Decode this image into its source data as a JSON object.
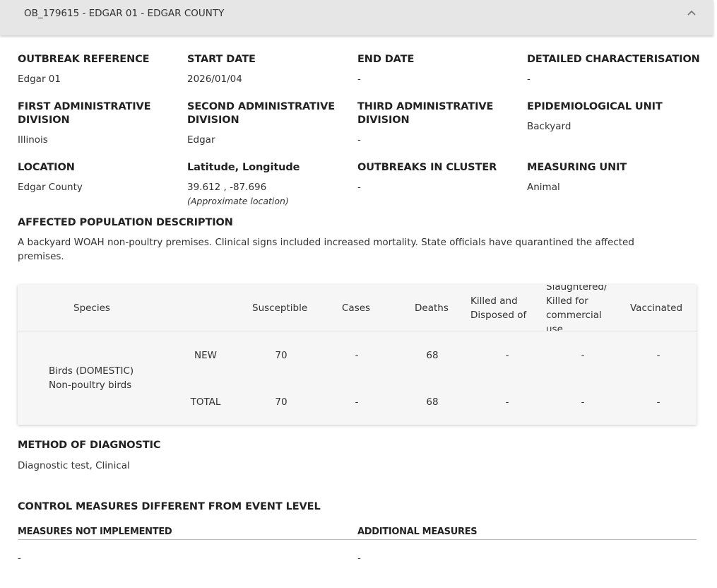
{
  "header": {
    "title": "OB_179615 - EDGAR 01 - EDGAR COUNTY",
    "toggle_icon": "chevron-up-icon"
  },
  "fields": {
    "outbreak_reference": {
      "label": "OUTBREAK REFERENCE",
      "value": "Edgar 01"
    },
    "start_date": {
      "label": "START DATE",
      "value": "2026/01/04"
    },
    "end_date": {
      "label": "END DATE",
      "value": "-"
    },
    "detailed_characterisation": {
      "label": "DETAILED CHARACTERISATION",
      "value": "-"
    },
    "first_admin_division": {
      "label_line1": "FIRST ADMINISTRATIVE",
      "label_line2": "DIVISION",
      "value": "Illinois"
    },
    "second_admin_division": {
      "label_line1": "SECOND ADMINISTRATIVE",
      "label_line2": "DIVISION",
      "value": "Edgar"
    },
    "third_admin_division": {
      "label_line1": "THIRD ADMINISTRATIVE",
      "label_line2": "DIVISION",
      "value": "-"
    },
    "epidemiological_unit": {
      "label": "EPIDEMIOLOGICAL UNIT",
      "value": "Backyard"
    },
    "location": {
      "label": "LOCATION",
      "value": "Edgar County"
    },
    "lat_long": {
      "label": "Latitude, Longitude",
      "value": "39.612 , -87.696",
      "note": "(Approximate location)"
    },
    "outbreaks_in_cluster": {
      "label": "OUTBREAKS IN CLUSTER",
      "value": "-"
    },
    "measuring_unit": {
      "label": "MEASURING UNIT",
      "value": "Animal"
    }
  },
  "affected_population": {
    "label": "AFFECTED POPULATION DESCRIPTION",
    "text": "A backyard WOAH non-poultry premises. Clinical signs included increased mortality. State officials have quarantined the affected premises."
  },
  "species_table": {
    "headers": {
      "species": "Species",
      "susceptible": "Susceptible",
      "cases": "Cases",
      "deaths": "Deaths",
      "killed_disposed_line1": "Killed and",
      "killed_disposed_line2": "Disposed of",
      "slaughtered_line1": "Slaughtered/",
      "slaughtered_line2": "Killed for",
      "slaughtered_line3": "commercial",
      "slaughtered_line4": "use",
      "vaccinated": "Vaccinated"
    },
    "species_line1": "Birds (DOMESTIC)",
    "species_line2": "Non-poultry birds",
    "rows": [
      {
        "type": "NEW",
        "susceptible": "70",
        "cases": "-",
        "deaths": "68",
        "killed_disposed": "-",
        "slaughtered": "-",
        "vaccinated": "-"
      },
      {
        "type": "TOTAL",
        "susceptible": "70",
        "cases": "-",
        "deaths": "68",
        "killed_disposed": "-",
        "slaughtered": "-",
        "vaccinated": "-"
      }
    ]
  },
  "method_of_diagnostic": {
    "label": "METHOD OF DIAGNOSTIC",
    "value": "Diagnostic test, Clinical"
  },
  "control_measures": {
    "label": "CONTROL MEASURES DIFFERENT FROM EVENT LEVEL",
    "not_implemented_label": "MEASURES NOT IMPLEMENTED",
    "not_implemented_value": "-",
    "additional_label": "ADDITIONAL MEASURES",
    "additional_value": "-"
  }
}
